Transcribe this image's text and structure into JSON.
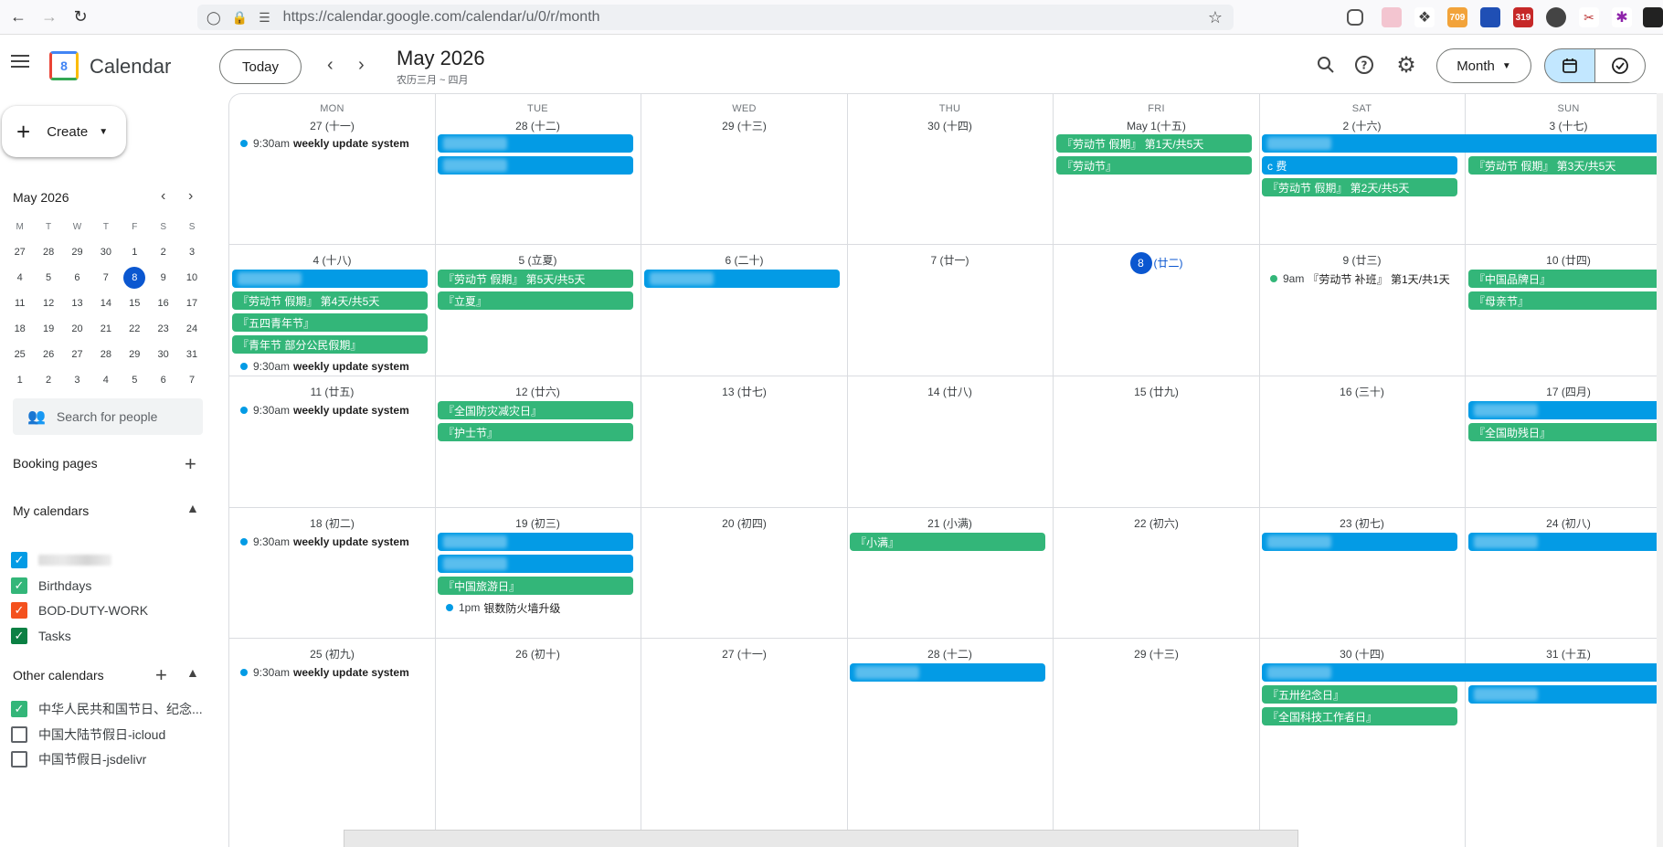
{
  "browser": {
    "url": "https://calendar.google.com/calendar/u/0/r/month",
    "badges": [
      "709",
      "319"
    ]
  },
  "header": {
    "app_name": "Calendar",
    "logo_day": "8",
    "today": "Today",
    "title": "May 2026",
    "lunar": "农历三月 ~ 四月",
    "view": "Month"
  },
  "sidebar": {
    "create": "Create",
    "mini_title": "May 2026",
    "dow": [
      "M",
      "T",
      "W",
      "T",
      "F",
      "S",
      "S"
    ],
    "weeks": [
      [
        "27",
        "28",
        "29",
        "30",
        "1",
        "2",
        "3"
      ],
      [
        "4",
        "5",
        "6",
        "7",
        "8",
        "9",
        "10"
      ],
      [
        "11",
        "12",
        "13",
        "14",
        "15",
        "16",
        "17"
      ],
      [
        "18",
        "19",
        "20",
        "21",
        "22",
        "23",
        "24"
      ],
      [
        "25",
        "26",
        "27",
        "28",
        "29",
        "30",
        "31"
      ],
      [
        "1",
        "2",
        "3",
        "4",
        "5",
        "6",
        "7"
      ]
    ],
    "search_people": "Search for people",
    "booking_pages": "Booking pages",
    "my_calendars": "My calendars",
    "my_cals": [
      {
        "name": "",
        "color": "#039be5",
        "checked": true
      },
      {
        "name": "Birthdays",
        "color": "#33b679",
        "checked": true
      },
      {
        "name": "BOD-DUTY-WORK",
        "color": "#f4511e",
        "checked": true
      },
      {
        "name": "Tasks",
        "color": "#0b8043",
        "checked": true
      }
    ],
    "other_calendars": "Other calendars",
    "other_cals": [
      {
        "name": "中华人民共和国节日、纪念...",
        "color": "#33b679",
        "checked": true
      },
      {
        "name": "中国大陆节假日-icloud",
        "color": "",
        "checked": false
      },
      {
        "name": "中国节假日-jsdelivr",
        "color": "",
        "checked": false
      }
    ]
  },
  "grid": {
    "dow": [
      "MON",
      "TUE",
      "WED",
      "THU",
      "FRI",
      "SAT",
      "SUN"
    ],
    "days": [
      [
        "27 (十一)",
        "28 (十二)",
        "29 (十三)",
        "30 (十四)",
        "May 1(十五)",
        "2 (十六)",
        "3 (十七)"
      ],
      [
        "4 (十八)",
        "5 (立夏)",
        "6 (二十)",
        "7 (廿一)",
        "8",
        "9 (廿三)",
        "10 (廿四)"
      ],
      [
        "11 (廿五)",
        "12 (廿六)",
        "13 (廿七)",
        "14 (廿八)",
        "15 (廿九)",
        "16 (三十)",
        "17 (四月)"
      ],
      [
        "18 (初二)",
        "19 (初三)",
        "20 (初四)",
        "21 (小满)",
        "22 (初六)",
        "23 (初七)",
        "24 (初八)"
      ],
      [
        "25 (初九)",
        "26 (初十)",
        "27 (十一)",
        "28 (十二)",
        "29 (十三)",
        "30 (十四)",
        "31 (十五)"
      ]
    ],
    "today_lunar": "(廿二)",
    "weekly_time": "9:30am",
    "weekly_title": "weekly update system",
    "events": {
      "w1_fri1": "『劳动节 假期』 第1天/共5天",
      "w1_fri2": "『劳动节』",
      "w1_sat2": "c 费",
      "w1_sat3": "『劳动节 假期』 第2天/共5天",
      "w1_sun2": "『劳动节 假期』 第3天/共5天",
      "w2_mon2": "『劳动节 假期』 第4天/共5天",
      "w2_mon3": "『五四青年节』",
      "w2_mon4": "『青年节 部分公民假期』",
      "w2_tue1": "『劳动节 假期』 第5天/共5天",
      "w2_tue2": "『立夏』",
      "w2_sat_time": "9am",
      "w2_sat_title": "『劳动节 补班』 第1天/共1天",
      "w2_sun1": "『中国品牌日』",
      "w2_sun2": "『母亲节』",
      "w3_tue1": "『全国防灾减灾日』",
      "w3_tue2": "『护士节』",
      "w3_sun2": "『全国助残日』",
      "w4_tue3": "『中国旅游日』",
      "w4_tue_time": "1pm",
      "w4_tue_title": "银数防火墙升级",
      "w4_thu1": "『小满』",
      "w5_sat2": "『五卅纪念日』",
      "w5_sat3": "『全国科技工作者日』"
    }
  },
  "colors": {
    "green": "#33b679",
    "blue": "#039be5",
    "accent": "#0b57d0"
  }
}
